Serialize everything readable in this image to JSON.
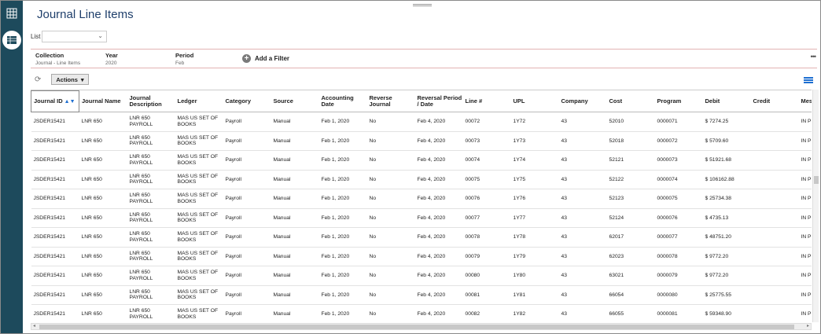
{
  "page": {
    "title": "Journal Line Items"
  },
  "list": {
    "label": "List",
    "value": ""
  },
  "filters": {
    "collection": {
      "label": "Collection",
      "value": "Journal - Line Items"
    },
    "year": {
      "label": "Year",
      "value": "2020"
    },
    "period": {
      "label": "Period",
      "value": "Feb"
    },
    "add_filter_label": "Add a Filter"
  },
  "toolbar": {
    "actions_label": "Actions"
  },
  "icons": [
    "grid-apps-icon",
    "table-icon",
    "refresh-icon",
    "more-icon",
    "column-settings-icon",
    "sort-asc-icon",
    "sort-desc-icon"
  ],
  "table": {
    "columns": [
      "Journal ID",
      "Journal Name",
      "Journal Description",
      "Ledger",
      "Category",
      "Source",
      "Accounting Date",
      "Reverse Journal",
      "Reversal Period / Date",
      "Line #",
      "UPL",
      "Company",
      "Cost",
      "Program",
      "Debit",
      "Credit",
      "Mes"
    ],
    "rows": [
      [
        "JSDER15421",
        "LNR 650",
        "LNR 650 PAYROLL",
        "MAS US SET OF BOOKS",
        "Payroll",
        "Manual",
        "Feb 1, 2020",
        "No",
        "Feb 4, 2020",
        "00072",
        "1Y72",
        "43",
        "52010",
        "0000071",
        "$ 7274.25",
        "",
        "IN PR"
      ],
      [
        "JSDER15421",
        "LNR 650",
        "LNR 650 PAYROLL",
        "MAS US SET OF BOOKS",
        "Payroll",
        "Manual",
        "Feb 1, 2020",
        "No",
        "Feb 4, 2020",
        "00073",
        "1Y73",
        "43",
        "52018",
        "0000072",
        "$ 5709.60",
        "",
        "IN PR"
      ],
      [
        "JSDER15421",
        "LNR 650",
        "LNR 650 PAYROLL",
        "MAS US SET OF BOOKS",
        "Payroll",
        "Manual",
        "Feb 1, 2020",
        "No",
        "Feb 4, 2020",
        "00074",
        "1Y74",
        "43",
        "52121",
        "0000073",
        "$ 51921.68",
        "",
        "IN PR"
      ],
      [
        "JSDER15421",
        "LNR 650",
        "LNR 650 PAYROLL",
        "MAS US SET OF BOOKS",
        "Payroll",
        "Manual",
        "Feb 1, 2020",
        "No",
        "Feb 4, 2020",
        "00075",
        "1Y75",
        "43",
        "52122",
        "0000074",
        "$ 106162.88",
        "",
        "IN PR"
      ],
      [
        "JSDER15421",
        "LNR 650",
        "LNR 650 PAYROLL",
        "MAS US SET OF BOOKS",
        "Payroll",
        "Manual",
        "Feb 1, 2020",
        "No",
        "Feb 4, 2020",
        "00076",
        "1Y76",
        "43",
        "52123",
        "0000075",
        "$ 25734.38",
        "",
        "IN PR"
      ],
      [
        "JSDER15421",
        "LNR 650",
        "LNR 650 PAYROLL",
        "MAS US SET OF BOOKS",
        "Payroll",
        "Manual",
        "Feb 1, 2020",
        "No",
        "Feb 4, 2020",
        "00077",
        "1Y77",
        "43",
        "52124",
        "0000076",
        "$ 4735.13",
        "",
        "IN PR"
      ],
      [
        "JSDER15421",
        "LNR 650",
        "LNR 650 PAYROLL",
        "MAS US SET OF BOOKS",
        "Payroll",
        "Manual",
        "Feb 1, 2020",
        "No",
        "Feb 4, 2020",
        "00078",
        "1Y78",
        "43",
        "62017",
        "0000077",
        "$ 48751.20",
        "",
        "IN PR"
      ],
      [
        "JSDER15421",
        "LNR 650",
        "LNR 650 PAYROLL",
        "MAS US SET OF BOOKS",
        "Payroll",
        "Manual",
        "Feb 1, 2020",
        "No",
        "Feb 4, 2020",
        "00079",
        "1Y79",
        "43",
        "62023",
        "0000078",
        "$ 9772.20",
        "",
        "IN PR"
      ],
      [
        "JSDER15421",
        "LNR 650",
        "LNR 650 PAYROLL",
        "MAS US SET OF BOOKS",
        "Payroll",
        "Manual",
        "Feb 1, 2020",
        "No",
        "Feb 4, 2020",
        "00080",
        "1Y80",
        "43",
        "63021",
        "0000079",
        "$ 9772.20",
        "",
        "IN PR"
      ],
      [
        "JSDER15421",
        "LNR 650",
        "LNR 650 PAYROLL",
        "MAS US SET OF BOOKS",
        "Payroll",
        "Manual",
        "Feb 1, 2020",
        "No",
        "Feb 4, 2020",
        "00081",
        "1Y81",
        "43",
        "66054",
        "0000080",
        "$ 25775.55",
        "",
        "IN PR"
      ],
      [
        "JSDER15421",
        "LNR 650",
        "LNR 650 PAYROLL",
        "MAS US SET OF BOOKS",
        "Payroll",
        "Manual",
        "Feb 1, 2020",
        "No",
        "Feb 4, 2020",
        "00082",
        "1Y82",
        "43",
        "66055",
        "0000081",
        "$ 59348.90",
        "",
        "IN PR"
      ]
    ]
  }
}
